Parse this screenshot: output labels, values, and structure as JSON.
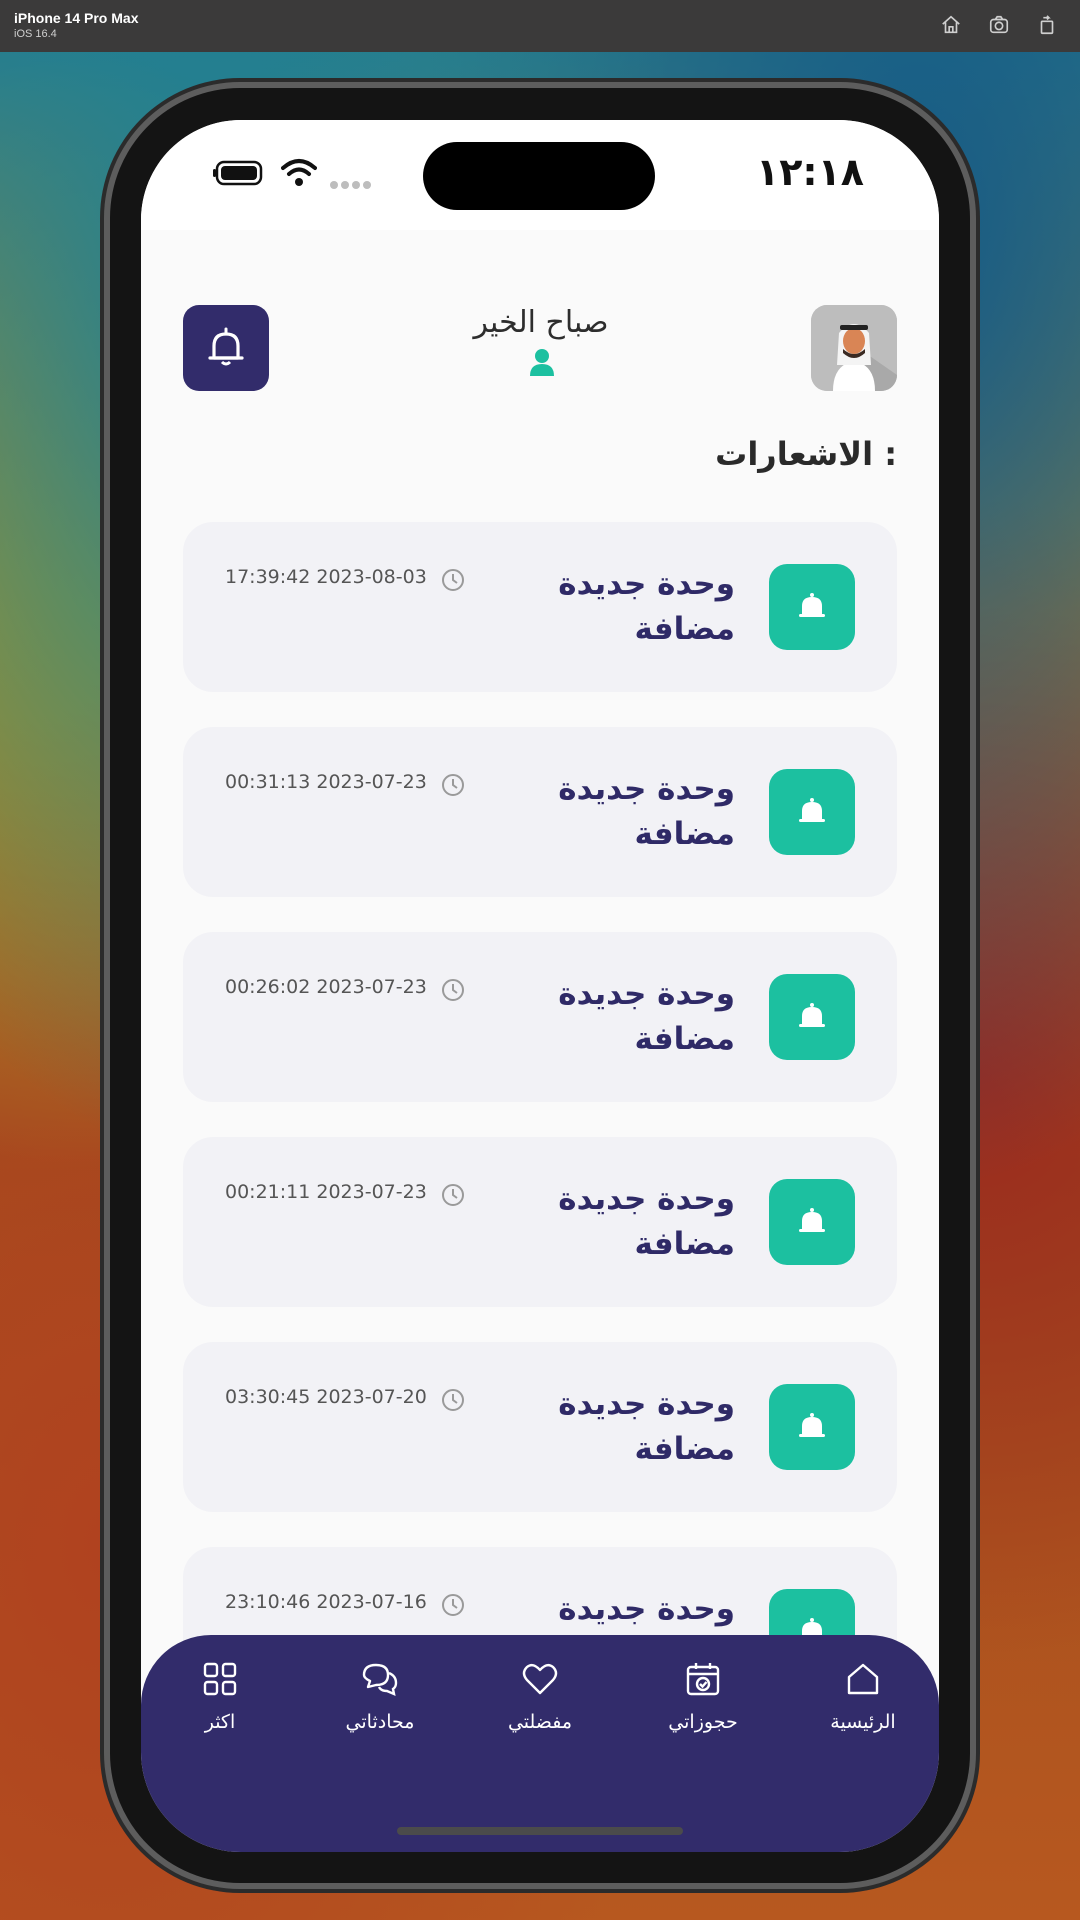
{
  "simulator": {
    "device": "iPhone 14 Pro Max",
    "os": "iOS 16.4",
    "icons": [
      "home-icon",
      "screenshot-icon",
      "rotate-icon"
    ]
  },
  "status_bar": {
    "time": "١٢:١٨"
  },
  "header": {
    "greeting": "صباح الخير"
  },
  "section_title": "الاشعارات :",
  "notifications": [
    {
      "title": "وحدة جديدة مضافة",
      "time": "17:39:42 2023-08-03"
    },
    {
      "title": "وحدة جديدة مضافة",
      "time": "00:31:13 2023-07-23"
    },
    {
      "title": "وحدة جديدة مضافة",
      "time": "00:26:02 2023-07-23"
    },
    {
      "title": "وحدة جديدة مضافة",
      "time": "00:21:11 2023-07-23"
    },
    {
      "title": "وحدة جديدة مضافة",
      "time": "03:30:45 2023-07-20"
    },
    {
      "title": "وحدة جديدة مضافة",
      "time": "23:10:46 2023-07-16"
    }
  ],
  "tabbar": {
    "items": [
      {
        "label": "الرئيسية",
        "icon": "home-icon"
      },
      {
        "label": "حجوزاتي",
        "icon": "calendar-check-icon"
      },
      {
        "label": "مفضلتي",
        "icon": "heart-icon"
      },
      {
        "label": "محادثاتي",
        "icon": "chat-icon"
      },
      {
        "label": "اكثر",
        "icon": "grid-icon"
      }
    ]
  },
  "colors": {
    "primary": "#322c6b",
    "accent": "#1cc0a0",
    "card_bg": "#f2f2f6"
  }
}
